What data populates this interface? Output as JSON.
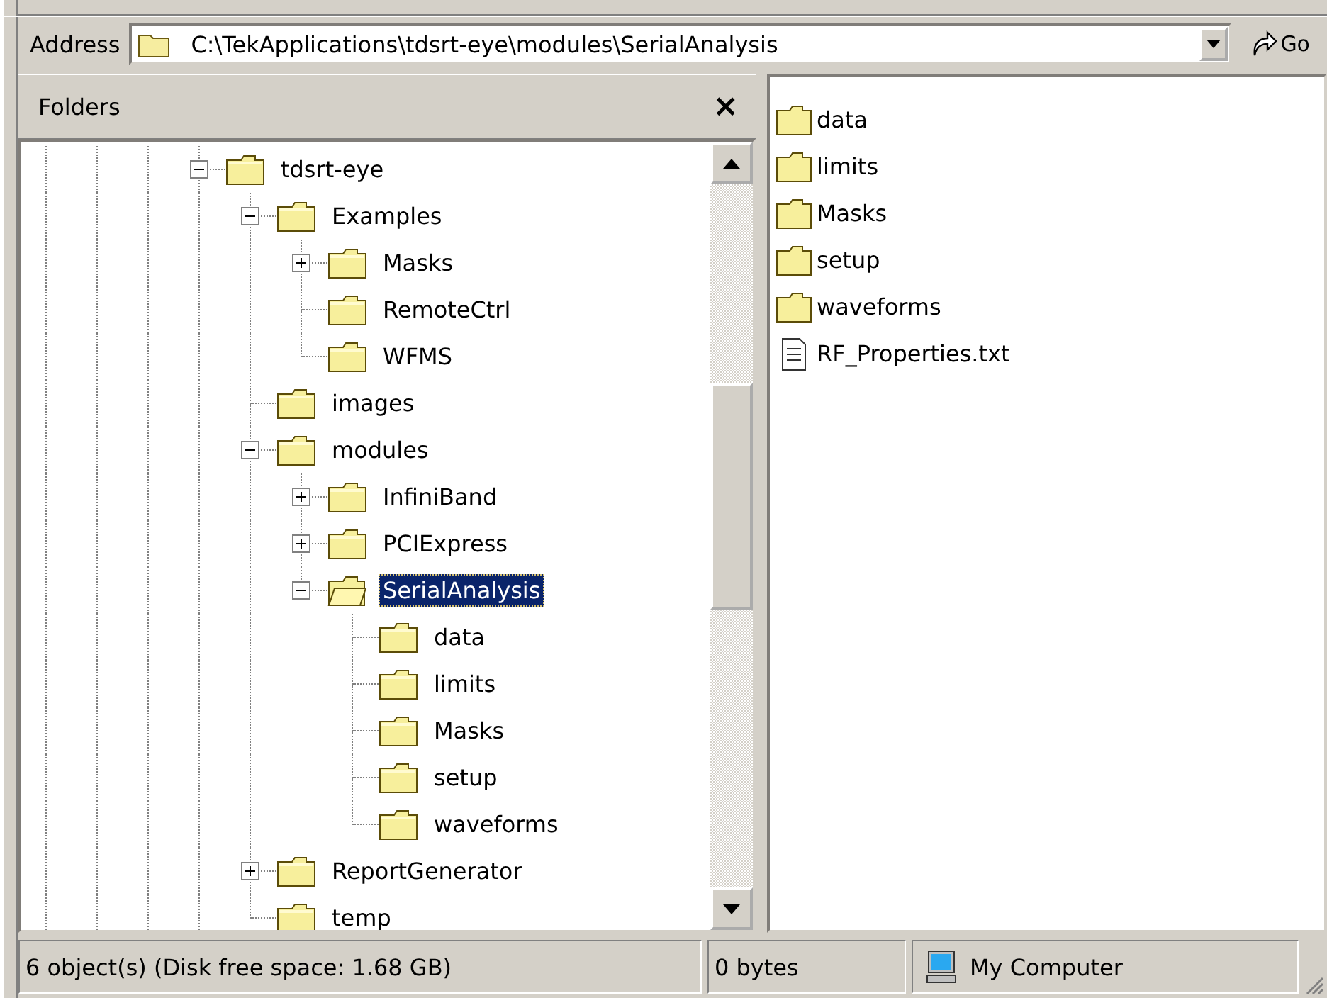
{
  "address_bar": {
    "label": "Address",
    "path": "C:\\TekApplications\\tdsrt-eye\\modules\\SerialAnalysis",
    "go_label": "Go"
  },
  "folders_pane": {
    "title": "Folders",
    "close": "×",
    "tree": [
      {
        "label": "tdsrt-eye",
        "expanded": true,
        "selected": false,
        "children": [
          {
            "label": "Examples",
            "expanded": true,
            "selected": false,
            "children": [
              {
                "label": "Masks",
                "expanded": false,
                "selected": false
              },
              {
                "label": "RemoteCtrl",
                "selected": false
              },
              {
                "label": "WFMS",
                "selected": false
              }
            ]
          },
          {
            "label": "images",
            "selected": false
          },
          {
            "label": "modules",
            "expanded": true,
            "selected": false,
            "children": [
              {
                "label": "InfiniBand",
                "expanded": false,
                "selected": false
              },
              {
                "label": "PCIExpress",
                "expanded": false,
                "selected": false
              },
              {
                "label": "SerialAnalysis",
                "expanded": true,
                "selected": true,
                "children": [
                  {
                    "label": "data",
                    "selected": false
                  },
                  {
                    "label": "limits",
                    "selected": false
                  },
                  {
                    "label": "Masks",
                    "selected": false
                  },
                  {
                    "label": "setup",
                    "selected": false
                  },
                  {
                    "label": "waveforms",
                    "selected": false
                  }
                ]
              }
            ]
          },
          {
            "label": "ReportGenerator",
            "expanded": false,
            "selected": false
          },
          {
            "label": "temp",
            "selected": false
          }
        ]
      }
    ]
  },
  "file_list": [
    {
      "name": "data",
      "kind": "folder"
    },
    {
      "name": "limits",
      "kind": "folder"
    },
    {
      "name": "Masks",
      "kind": "folder"
    },
    {
      "name": "setup",
      "kind": "folder"
    },
    {
      "name": "waveforms",
      "kind": "folder"
    },
    {
      "name": "RF_Properties.txt",
      "kind": "file"
    }
  ],
  "status_bar": {
    "objects": "6 object(s) (Disk free space: 1.68 GB)",
    "size": "0 bytes",
    "zone": "My Computer"
  }
}
